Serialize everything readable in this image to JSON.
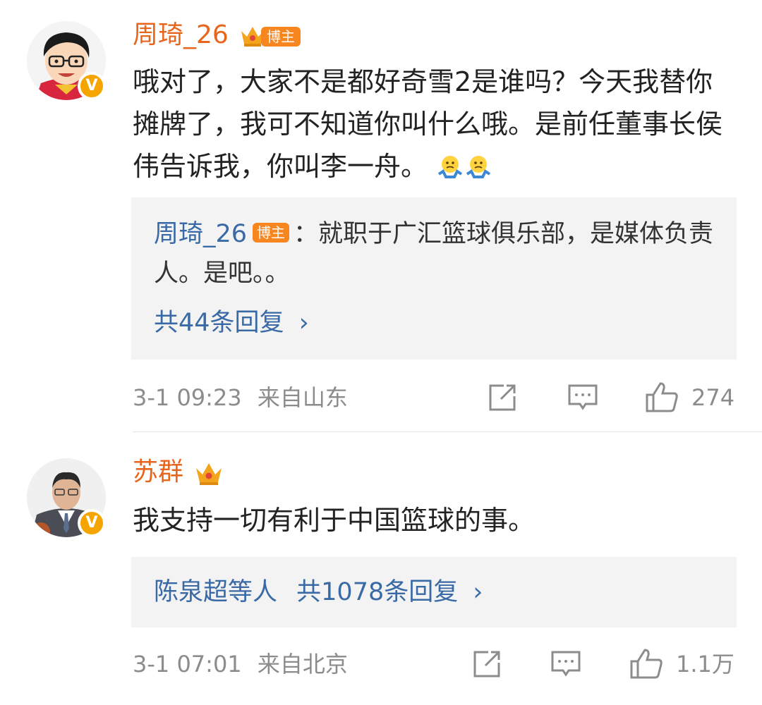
{
  "comments": [
    {
      "username": "周琦_26",
      "badge": "博主",
      "verified_mark": "V",
      "text": "哦对了，大家不是都好奇雪2是谁吗？今天我替你摊牌了，我可不知道你叫什么哦。是前任董事长侯伟告诉我，你叫李一舟。",
      "emoji": [
        "shrug-emoji",
        "shrug-emoji"
      ],
      "reply_preview": {
        "username": "周琦_26",
        "badge": "博主",
        "text": "：就职于广汇篮球俱乐部，是媒体负责人。是吧。。",
        "more_replies": "共44条回复",
        "chevron": "›"
      },
      "time": "3-1 09:23",
      "location": "来自山东",
      "likes": "274"
    },
    {
      "username": "苏群",
      "verified_mark": "V",
      "text": "我支持一切有利于中国篮球的事。",
      "reply_preview": {
        "repliers": "陈泉超等人",
        "more_replies": "共1078条回复",
        "chevron": "›"
      },
      "time": "3-1 07:01",
      "location": "来自北京",
      "likes": "1.1万"
    }
  ],
  "colors": {
    "username": "#e8661c",
    "link": "#3a6aa6",
    "meta": "#8c8c8c",
    "badge": "#f7861e",
    "verified": "#f6a400",
    "reply_bg": "#f3f3f3"
  },
  "icons": [
    "share-icon",
    "comment-icon",
    "like-icon",
    "crown-icon"
  ]
}
